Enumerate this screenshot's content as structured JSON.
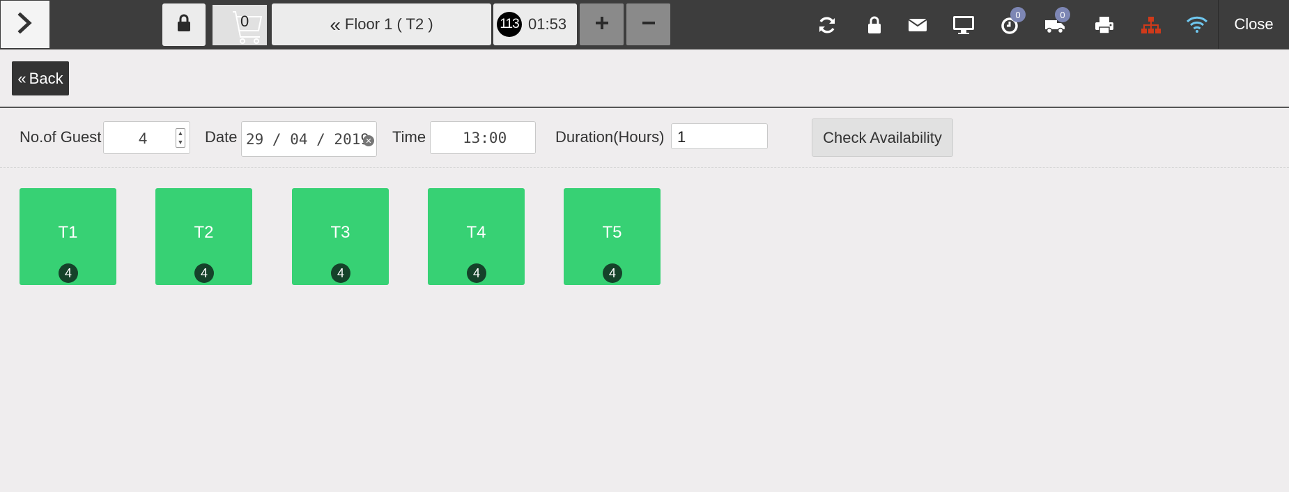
{
  "header": {
    "cart_count": "0",
    "floor_label": "Floor 1 ( T2 )",
    "order_number": "113",
    "order_time": "01:53",
    "notifications": {
      "pending_count": "0",
      "delivery_count": "0"
    },
    "close_label": "Close",
    "icons": [
      "chevron-right-icon",
      "lock-icon",
      "cart-icon",
      "double-chevron-left-icon",
      "plus-icon",
      "minus-icon",
      "refresh-icon",
      "lock-icon",
      "envelope-icon",
      "monitor-icon",
      "clock-icon",
      "truck-icon",
      "printer-icon",
      "sitemap-icon",
      "wifi-icon"
    ],
    "colors": {
      "bar": "#3d3d3d",
      "sitemap": "#d03a1a",
      "wifi": "#6fc7ef",
      "badge": "#7d86b4"
    }
  },
  "back": {
    "label": "Back"
  },
  "form": {
    "guest_label": "No.of Guest",
    "guest_value": "4",
    "date_label": "Date",
    "date_value": "29 / 04 / 2019",
    "time_label": "Time",
    "time_value": "13:00",
    "duration_label": "Duration(Hours)",
    "duration_value": "1",
    "check_label": "Check Availability"
  },
  "tables": [
    {
      "name": "T1",
      "seats": "4"
    },
    {
      "name": "T2",
      "seats": "4"
    },
    {
      "name": "T3",
      "seats": "4"
    },
    {
      "name": "T4",
      "seats": "4"
    },
    {
      "name": "T5",
      "seats": "4"
    }
  ],
  "table_color": "#37d174"
}
